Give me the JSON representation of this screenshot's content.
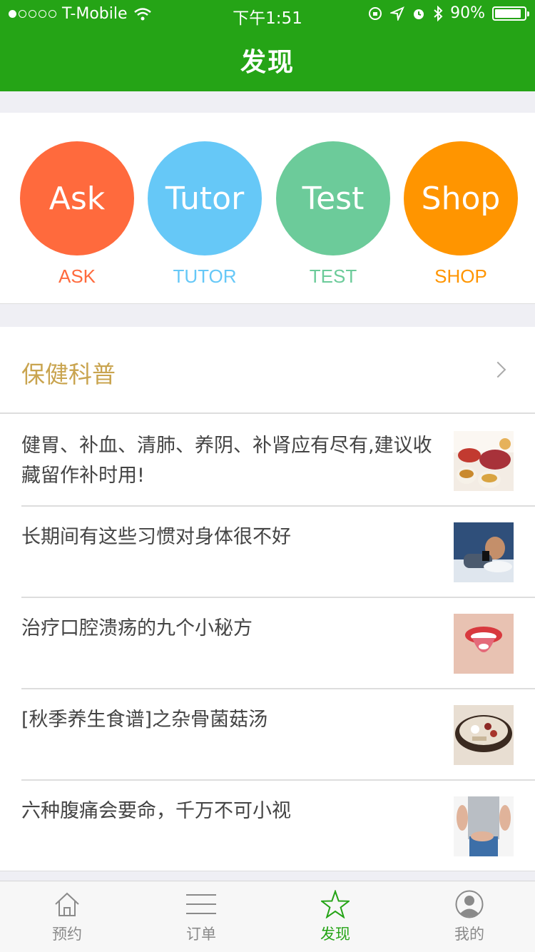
{
  "status_bar": {
    "carrier": "T-Mobile",
    "time": "下午1:51",
    "battery": "90%",
    "battery_level": 0.9
  },
  "nav": {
    "title": "发现"
  },
  "quick_actions": [
    {
      "circle_text": "Ask",
      "label": "ASK",
      "color": "#ff6a3d"
    },
    {
      "circle_text": "Tutor",
      "label": "TUTOR",
      "color": "#66c8f7"
    },
    {
      "circle_text": "Test",
      "label": "TEST",
      "color": "#6ccb9a"
    },
    {
      "circle_text": "Shop",
      "label": "SHOP",
      "color": "#ff9500"
    }
  ],
  "section": {
    "title": "保健科普"
  },
  "articles": [
    {
      "title": "健胃、补血、清肺、养阴、补肾应有尽有,建议收藏留作补时用!",
      "thumb": "herbal-tea-image"
    },
    {
      "title": "长期间有这些习惯对身体很不好",
      "thumb": "man-using-phone-in-bed-image"
    },
    {
      "title": "治疗口腔溃疡的九个小秘方",
      "thumb": "mouth-with-pill-image"
    },
    {
      "title": "[秋季养生食谱]之杂骨菌菇汤",
      "thumb": "soup-bowl-image"
    },
    {
      "title": "六种腹痛会要命，千万不可小视",
      "thumb": "abdominal-pain-image"
    }
  ],
  "tabbar": {
    "active_color": "#25a416",
    "tabs": [
      {
        "label": "预约",
        "icon": "home-icon"
      },
      {
        "label": "订单",
        "icon": "list-icon"
      },
      {
        "label": "发现",
        "icon": "star-icon",
        "active": true
      },
      {
        "label": "我的",
        "icon": "profile-icon"
      }
    ]
  }
}
